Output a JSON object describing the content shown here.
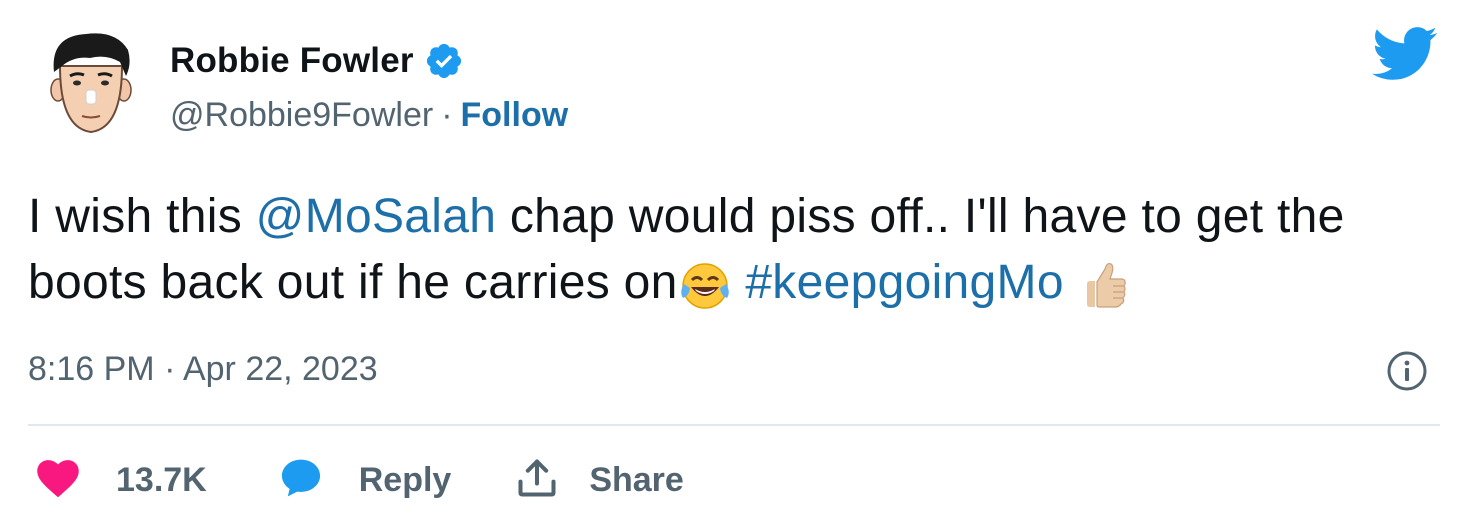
{
  "author": {
    "name": "Robbie Fowler",
    "handle": "@Robbie9Fowler",
    "separator": "·",
    "follow_label": "Follow"
  },
  "tweet": {
    "part1": "I wish this ",
    "mention": "@MoSalah",
    "part2": " chap would piss off.. I'll have to get the boots back out if he carries on",
    "hashtag": "#keepgoingMo",
    "emojis": [
      "face-with-tears-of-joy-emoji",
      "thumbs-up-emoji"
    ]
  },
  "timestamp": "8:16 PM · Apr 22, 2023",
  "actions": {
    "like_count": "13.7K",
    "reply_label": "Reply",
    "share_label": "Share"
  },
  "colors": {
    "link": "#1d6fa9",
    "secondary_text": "#536471",
    "heart": "#f91880",
    "twitter_blue": "#1d9bf0"
  },
  "icons": [
    "twitter-bird-icon",
    "verified-badge-icon",
    "info-icon",
    "heart-icon",
    "reply-bubble-icon",
    "share-icon"
  ]
}
